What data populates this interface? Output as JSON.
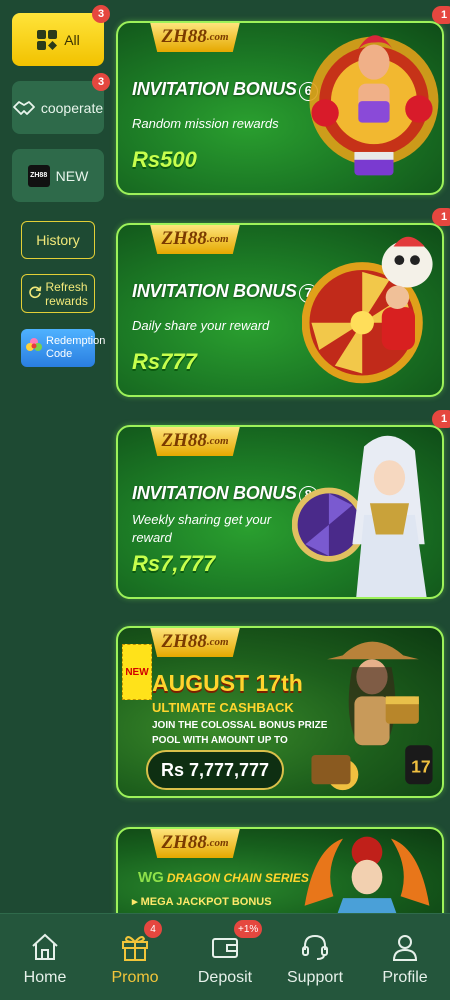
{
  "sidebar": {
    "categories": [
      {
        "label": "All",
        "badge": "3"
      },
      {
        "label": "cooperate",
        "badge": "3"
      },
      {
        "label": "NEW",
        "logo_text": "ZH88"
      }
    ],
    "history_label": "History",
    "refresh_label": "Refresh rewards",
    "redeem_label": "Redemption Code"
  },
  "promos": [
    {
      "logo": "ZH88",
      "logo_suffix": ".com",
      "title": "INVITATION BONUS",
      "num": "6",
      "subtitle": "Random mission rewards",
      "amount": "Rs500",
      "badge": "1"
    },
    {
      "logo": "ZH88",
      "logo_suffix": ".com",
      "title": "INVITATION BONUS",
      "num": "7",
      "subtitle": "Daily share your reward",
      "amount": "Rs777",
      "badge": "1"
    },
    {
      "logo": "ZH88",
      "logo_suffix": ".com",
      "title": "INVITATION BONUS",
      "num": "8",
      "subtitle": "Weekly sharing get your reward",
      "amount": "Rs7,777",
      "badge": "1"
    }
  ],
  "august": {
    "logo": "ZH88",
    "logo_suffix": ".com",
    "new_tag": "NEW",
    "title": "AUGUST 17th",
    "subtitle": "ULTIMATE CASHBACK",
    "desc": "JOIN THE COLOSSAL BONUS PRIZE POOL WITH AMOUNT UP TO",
    "amount": "Rs 7,777,777"
  },
  "dragon": {
    "logo": "ZH88",
    "logo_suffix": ".com",
    "series": "DRAGON CHAIN SERIES",
    "brand": "WG",
    "tag": "MEGA JACKPOT BONUS"
  },
  "nav": [
    {
      "label": "Home",
      "icon": "home-icon"
    },
    {
      "label": "Promo",
      "icon": "gift-icon",
      "badge": "4"
    },
    {
      "label": "Deposit",
      "icon": "wallet-icon",
      "badge": "+1%"
    },
    {
      "label": "Support",
      "icon": "headset-icon"
    },
    {
      "label": "Profile",
      "icon": "user-icon"
    }
  ],
  "colors": {
    "accent": "#f2c53a",
    "background": "#1e4a33",
    "badge": "#e5473f",
    "card_border": "#9df25a"
  }
}
